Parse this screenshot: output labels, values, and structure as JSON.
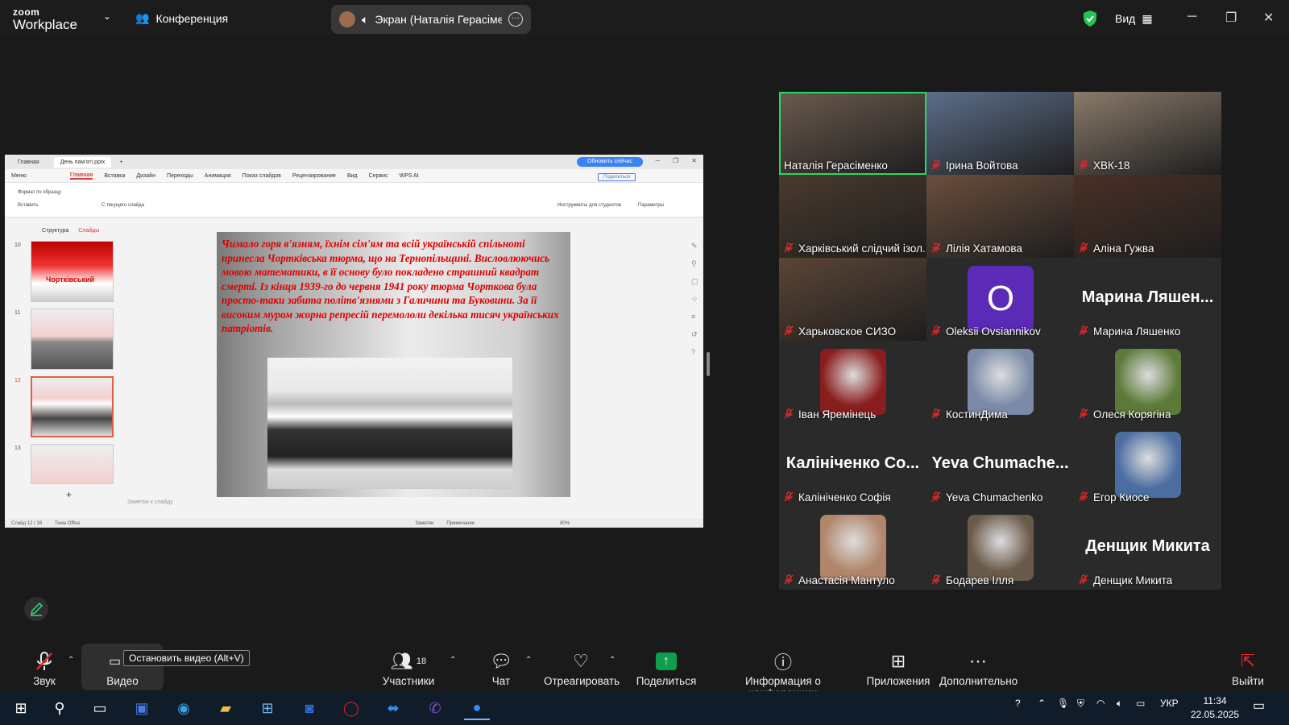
{
  "app": {
    "logo_line1": "zoom",
    "logo_line2": "Workplace",
    "conference_label": "Конференция",
    "screen_share_label": "Экран (Наталія Герасіменко)",
    "view_label": "Вид"
  },
  "presentation": {
    "tabs": [
      "Главная",
      "День пам'яті.pptx"
    ],
    "update_label": "Обновить сейчас",
    "menu": [
      "Меню",
      "Главная",
      "Вставка",
      "Дизайн",
      "Переходы",
      "Анимация",
      "Показ слайдов",
      "Рецензирование",
      "Вид",
      "Сервис",
      "WPS AI"
    ],
    "share_label": "Поделиться",
    "ribbon": {
      "format": "Формат по образцу",
      "paste": "Вставить",
      "from_current": "С текущего слайда",
      "tools": "Инструменты для студентов",
      "params": "Параметры"
    },
    "sidebar_tabs": [
      "Структура",
      "Слайды"
    ],
    "thumbs": [
      {
        "num": "10",
        "caption": "Чортківський"
      },
      {
        "num": "11"
      },
      {
        "num": "12"
      },
      {
        "num": "13"
      }
    ],
    "slide_text": "Чимало горя в'язням, їхнім сім'ям та всій українській спільноті принесла Чортківська тюрма, що на Тернопільщині. Висловлюючись мовою математики, в її основу було покладено страшний квадрат смерті. Із кінця 1939-го до червня 1941 року тюрма Чорткова була просто-таки забита політв'язнями з Галичини та Буковини. За її високим муром жорна репресій перемололи декілька тисяч українських патріотів.",
    "notes_placeholder": "Заметки к слайду",
    "status": {
      "slide": "Слайд 12 / 18",
      "theme": "Тема Office",
      "notes": "Заметки",
      "comment": "Примечание",
      "zoom": "80%"
    }
  },
  "participants": [
    {
      "name": "Наталія Герасіменко",
      "mic_off": false,
      "active": true,
      "color": "#6b5a4e"
    },
    {
      "name": "Ірина Войтова",
      "mic_off": true,
      "color": "#5c6e8a"
    },
    {
      "name": "ХВК-18",
      "mic_off": true,
      "color": "#8a7a6a"
    },
    {
      "name": "Харківський слідчий ізол...",
      "mic_off": true,
      "color": "#4a3a2e"
    },
    {
      "name": "Лілія Хатамова",
      "mic_off": true,
      "color": "#6a4e3c"
    },
    {
      "name": "Аліна Гужва",
      "mic_off": true,
      "color": "#4a3026"
    },
    {
      "name": "Харьковское СИЗО",
      "mic_off": true,
      "color": "#5b4536"
    },
    {
      "name": "Oleksii Ovsiannikov",
      "mic_off": true,
      "initial": "O"
    },
    {
      "name": "Марина Ляшенко",
      "mic_off": true,
      "big": "Марина  Ляшен..."
    },
    {
      "name": "Іван Яремінець",
      "mic_off": true,
      "avatar_color": "#8a1e1e"
    },
    {
      "name": "КостинДима",
      "mic_off": true,
      "avatar_color": "#7b8aa8"
    },
    {
      "name": "Олеся Корягіна",
      "mic_off": true,
      "avatar_color": "#5d7a3a"
    },
    {
      "name": "Калініченко Софія",
      "mic_off": true,
      "big": "Калініченко  Со..."
    },
    {
      "name": "Yeva Chumachenko",
      "mic_off": true,
      "big": "Yeva  Chumache..."
    },
    {
      "name": "Егор Киосе",
      "mic_off": true,
      "avatar_color": "#4b6da0"
    },
    {
      "name": "Анастасія Мантуло",
      "mic_off": true,
      "avatar_color": "#b0856a"
    },
    {
      "name": "Бодарев Ілля",
      "mic_off": true,
      "avatar_color": "#6a5a4a"
    },
    {
      "name": "Денщик Микита",
      "mic_off": true,
      "big": "Денщик  Микита"
    }
  ],
  "toolbar": {
    "audio": "Звук",
    "video": "Видео",
    "video_tooltip": "Остановить видео (Alt+V)",
    "participants": "Участники",
    "participants_count": "18",
    "chat": "Чат",
    "react": "Отреагировать",
    "share": "Поделиться",
    "info": "Информация о конференции",
    "apps": "Приложения",
    "more": "Дополнительно",
    "leave": "Выйти"
  },
  "taskbar": {
    "lang": "УКР",
    "time": "11:34",
    "date": "22.05.2025"
  },
  "colors": {
    "active_speaker": "#26d962",
    "share_green": "#0e9f4d",
    "mic_red": "#e02828"
  }
}
